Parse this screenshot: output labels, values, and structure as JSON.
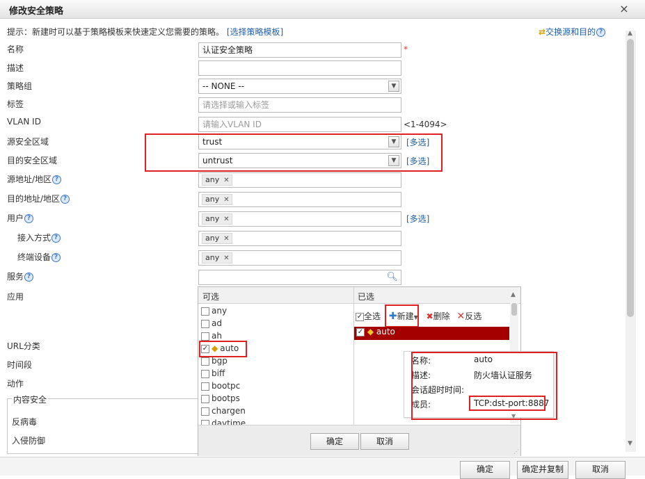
{
  "dialog": {
    "title": "修改安全策略",
    "close_label": "×"
  },
  "hint": {
    "text": "提示：新建时可以基于策略模板来快速定义您需要的策略。",
    "link": "[选择策略模板]"
  },
  "swap_label": "交换源和目的",
  "help_mark": "?",
  "form": {
    "name": {
      "label": "名称",
      "value": "认证安全策略",
      "required_mark": "*"
    },
    "description": {
      "label": "描述",
      "value": ""
    },
    "policy_group": {
      "label": "策略组",
      "value": "-- NONE --"
    },
    "tag": {
      "label": "标签",
      "placeholder": "请选择或输入标签"
    },
    "vlan": {
      "label": "VLAN ID",
      "placeholder": "请输入VLAN ID",
      "range": "<1-4094>"
    },
    "src_zone": {
      "label": "源安全区域",
      "value": "trust",
      "multi": "[多选]"
    },
    "dst_zone": {
      "label": "目的安全区域",
      "value": "untrust",
      "multi": "[多选]"
    },
    "src_addr": {
      "label": "源地址/地区",
      "tag": "any"
    },
    "dst_addr": {
      "label": "目的地址/地区",
      "tag": "any"
    },
    "user": {
      "label": "用户",
      "tag": "any",
      "multi": "[多选]"
    },
    "access_mode": {
      "label": "接入方式",
      "tag": "any"
    },
    "terminal": {
      "label": "终端设备",
      "tag": "any"
    },
    "service": {
      "label": "服务"
    },
    "application": {
      "label": "应用"
    },
    "url_category": {
      "label": "URL分类"
    },
    "time_range": {
      "label": "时间段"
    },
    "action": {
      "label": "动作"
    },
    "content_security": {
      "legend": "内容安全",
      "antivirus": "反病毒",
      "ips": "入侵防御"
    }
  },
  "picker": {
    "available_header": "可选",
    "selected_header": "已选",
    "available": [
      {
        "label": "any",
        "checked": false
      },
      {
        "label": "ad",
        "checked": false
      },
      {
        "label": "ah",
        "checked": false
      },
      {
        "label": "auto",
        "checked": true
      },
      {
        "label": "bgp",
        "checked": false
      },
      {
        "label": "biff",
        "checked": false
      },
      {
        "label": "bootpc",
        "checked": false
      },
      {
        "label": "bootps",
        "checked": false
      },
      {
        "label": "chargen",
        "checked": false
      },
      {
        "label": "daytime",
        "checked": false
      }
    ],
    "toolbar": {
      "select_all": "全选",
      "new": "新建",
      "delete": "删除",
      "invert": "反选"
    },
    "selected": [
      {
        "label": "auto",
        "checked": true
      }
    ],
    "ok": "确定",
    "cancel": "取消"
  },
  "tooltip": {
    "name_label": "名称:",
    "name_value": "auto",
    "desc_label": "描述:",
    "desc_value": "防火墙认证服务",
    "timeout_label": "会话超时时间:",
    "member_label": "成员:",
    "member_value": "TCP:dst-port:8887"
  },
  "footer": {
    "ok": "确定",
    "ok_copy": "确定并复制",
    "cancel": "取消"
  },
  "colors": {
    "accent_link": "#1f5fa8",
    "highlight_red": "#e02020",
    "selected_row": "#a50000"
  }
}
